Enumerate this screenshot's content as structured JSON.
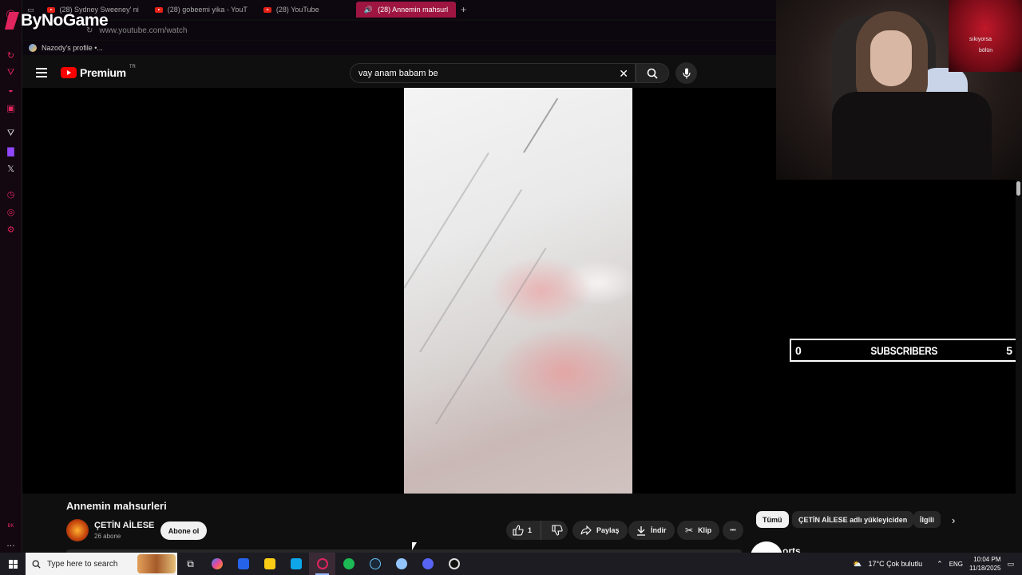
{
  "browser": {
    "tabs": [
      {
        "label": "(28) Sydney Sweeney' ni",
        "active": false
      },
      {
        "label": "(28) gobeemi yika - YouT",
        "active": false
      },
      {
        "label": "(28) YouTube",
        "active": false
      },
      {
        "label": "(28) Annemin mahsurl",
        "active": true
      }
    ],
    "new_tab_label": "+",
    "url": "www.youtube.com/watch",
    "bookmark": "Nazody's profile •..."
  },
  "overlay": {
    "logo": "ByNoGame",
    "cam_caption_1": "sıkıyorsa",
    "cam_caption_2": "bölün",
    "subscriber_box": {
      "left": "0",
      "label": "SUBSCRIBERS",
      "right": "5"
    }
  },
  "youtube": {
    "brand": "Premium",
    "region": "TR",
    "search_query": "vay anam babam be",
    "video": {
      "title": "Annemin mahsurleri",
      "channel": "ÇETİN AİLESE",
      "subscribers": "26 abone",
      "subscribe_label": "Abone ol",
      "likes": "1",
      "share_label": "Paylaş",
      "download_label": "İndir",
      "clip_label": "Klip",
      "more_label": "•••"
    },
    "chips": [
      "Tümü",
      "ÇETİN AİLESE adlı yükleyiciden",
      "İlgili"
    ],
    "shorts_label": "orts"
  },
  "taskbar": {
    "search_placeholder": "Type here to search",
    "weather": "17°C  Çok bulutlu",
    "language": "ENG",
    "time": "10:04 PM",
    "date": "11/18/2025",
    "rail_label": "BK"
  },
  "colors": {
    "accent": "#e0245e",
    "youtube_red": "#ff0000",
    "active_tab": "#9d1540"
  }
}
